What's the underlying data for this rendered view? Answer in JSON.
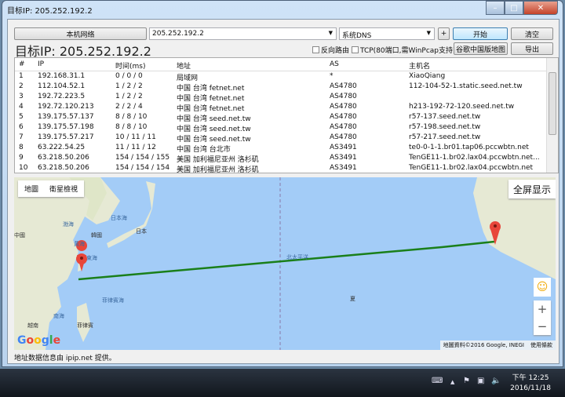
{
  "window": {
    "title": "目标IP: 205.252.192.2",
    "min": "–",
    "max": "□",
    "close": "✕"
  },
  "toolbar": {
    "local_network": "本机网络",
    "target": "205.252.192.2",
    "dns": "系统DNS",
    "plus": "+",
    "start": "开始",
    "clear": "清空",
    "google_map_cn": "谷歌中国版地图",
    "export": "导出",
    "reverse_route": "反向路由",
    "tcp": "TCP(80端口,需WinPcap支持)"
  },
  "heading": "目标IP: 205.252.192.2",
  "table": {
    "headers": [
      "#",
      "IP",
      "时间(ms)",
      "地址",
      "AS",
      "主机名"
    ],
    "rows": [
      [
        "1",
        "192.168.31.1",
        "0 / 0 / 0",
        "局域网",
        "*",
        "XiaoQiang"
      ],
      [
        "2",
        "112.104.52.1",
        "1 / 2 / 2",
        "中国 台湾 fetnet.net",
        "AS4780",
        "112-104-52-1.static.seed.net.tw"
      ],
      [
        "3",
        "192.72.223.5",
        "1 / 2 / 2",
        "中国 台湾 fetnet.net",
        "AS4780",
        ""
      ],
      [
        "4",
        "192.72.120.213",
        "2 / 2 / 4",
        "中国 台湾 fetnet.net",
        "AS4780",
        "h213-192-72-120.seed.net.tw"
      ],
      [
        "5",
        "139.175.57.137",
        "8 / 8 / 10",
        "中国 台湾 seed.net.tw",
        "AS4780",
        "r57-137.seed.net.tw"
      ],
      [
        "6",
        "139.175.57.198",
        "8 / 8 / 10",
        "中国 台湾 seed.net.tw",
        "AS4780",
        "r57-198.seed.net.tw"
      ],
      [
        "7",
        "139.175.57.217",
        "10 / 11 / 11",
        "中国 台湾 seed.net.tw",
        "AS4780",
        "r57-217.seed.net.tw"
      ],
      [
        "8",
        "63.222.54.25",
        "11 / 11 / 12",
        "中国 台湾 台北市",
        "AS3491",
        "te0-0-1-1.br01.tap06.pccwbtn.net"
      ],
      [
        "9",
        "63.218.50.206",
        "154 / 154 / 155",
        "美国 加利福尼亚州 洛杉矶",
        "AS3491",
        "TenGE11-1.br02.lax04.pccwbtn.net..."
      ],
      [
        "10",
        "63.218.50.206",
        "154 / 154 / 154",
        "美国 加利福尼亚州 洛杉矶",
        "AS3491",
        "TenGE11-1.br02.lax04.pccwbtn.net"
      ]
    ]
  },
  "map": {
    "type_map": "地圖",
    "type_satellite": "衛星檢視",
    "fullscreen": "全屏显示",
    "zoom_in": "+",
    "zoom_out": "−",
    "google": "Google",
    "attribution": "地圖資料©2016 Google, INEGI",
    "terms": "使用條款",
    "labels": {
      "pacific": "北太平洋",
      "japan_sea": "日本海",
      "japan": "日本",
      "korea": "韓國",
      "yellow_sea": "黃海",
      "east_sea": "東海",
      "philippine_sea": "菲律賓海",
      "south_sea": "南海",
      "philippines": "菲律賓",
      "vietnam": "越南",
      "hawaii": "夏",
      "bohai": "渤海",
      "china": "中國"
    },
    "route_color": "#1a7f1a"
  },
  "footer": "地址数据信息由 ipip.net 提供。",
  "taskbar": {
    "time": "下午 12:25",
    "date": "2016/11/18"
  }
}
